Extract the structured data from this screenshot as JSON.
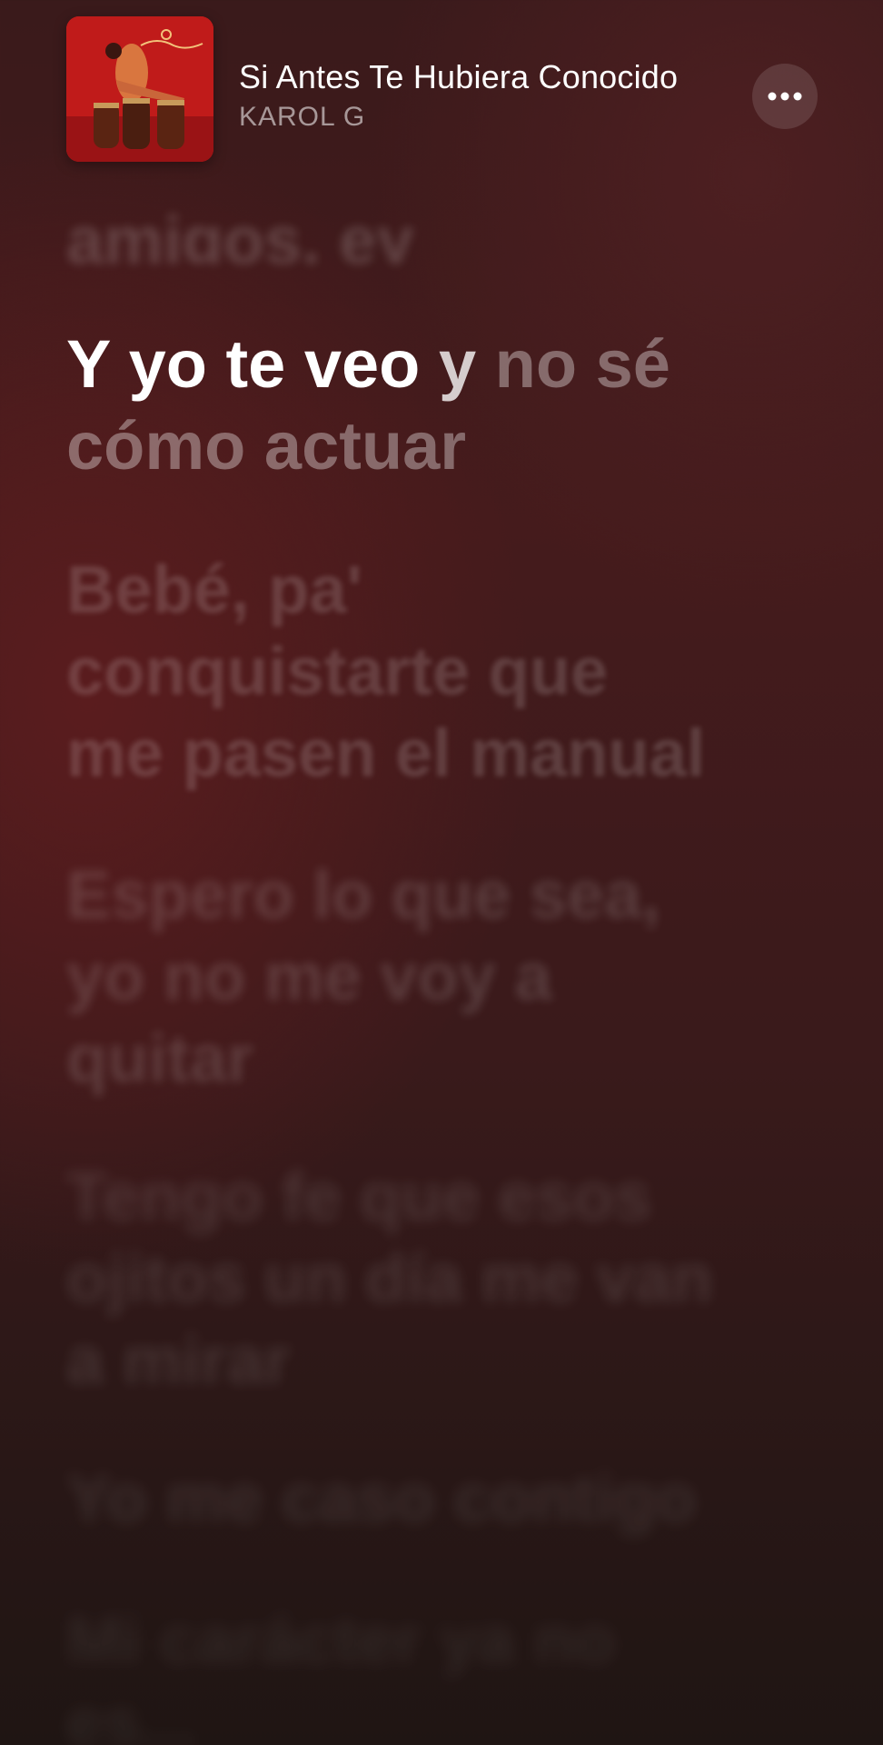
{
  "now_playing": {
    "title": "Si Antes Te Hubiera Conocido",
    "artist": "KAROL G",
    "artwork_icon": "album-artwork",
    "more_icon": "ellipsis-icon"
  },
  "lyrics": {
    "previous": "amigos, ey",
    "current": {
      "sung": "Y yo te veo ",
      "singing": "y",
      "upcoming": " no sé cómo actuar"
    },
    "upcoming": [
      "Bebé, pa' conquistarte que me pasen el manual",
      "Espero lo que sea, yo no me voy a quitar",
      "Tengo fe que esos ojitos un día me van a mirar",
      "Yo me caso contigo",
      "Mi carácter ya no es..."
    ]
  },
  "colors": {
    "background_top": "#3a1a1b",
    "background_bottom": "#1f1513",
    "accent_red": "#c41d1b"
  }
}
